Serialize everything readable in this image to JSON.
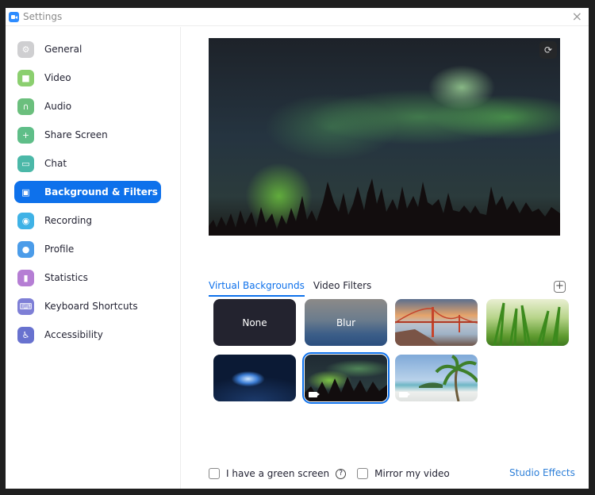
{
  "window": {
    "title": "Settings",
    "close_icon": "×"
  },
  "sidebar": {
    "items": [
      {
        "label": "General",
        "icon": "gear-icon",
        "color": "#cfcfd1",
        "glyph": "⚙"
      },
      {
        "label": "Video",
        "icon": "video-camera-icon",
        "color": "#8bcf6f",
        "glyph": "■"
      },
      {
        "label": "Audio",
        "icon": "headphones-icon",
        "color": "#6bbf7d",
        "glyph": "∩"
      },
      {
        "label": "Share Screen",
        "icon": "share-screen-icon",
        "color": "#5fbe88",
        "glyph": "+"
      },
      {
        "label": "Chat",
        "icon": "chat-bubble-icon",
        "color": "#4bb8a8",
        "glyph": "▭"
      },
      {
        "label": "Background & Filters",
        "icon": "background-icon",
        "color": "#0e71eb",
        "glyph": "▣",
        "active": true
      },
      {
        "label": "Recording",
        "icon": "record-icon",
        "color": "#3fb2e6",
        "glyph": "◉"
      },
      {
        "label": "Profile",
        "icon": "profile-icon",
        "color": "#4b9ce9",
        "glyph": "●"
      },
      {
        "label": "Statistics",
        "icon": "statistics-icon",
        "color": "#b57ed4",
        "glyph": "▮"
      },
      {
        "label": "Keyboard Shortcuts",
        "icon": "keyboard-icon",
        "color": "#7e7fd6",
        "glyph": "⌨"
      },
      {
        "label": "Accessibility",
        "icon": "accessibility-icon",
        "color": "#6872cf",
        "glyph": "♿"
      }
    ]
  },
  "main": {
    "rotate_icon": "⟳",
    "tabs": [
      {
        "label": "Virtual Backgrounds",
        "active": true
      },
      {
        "label": "Video Filters",
        "active": false
      }
    ],
    "add_icon": "+",
    "backgrounds": [
      {
        "name": "none",
        "label": "None"
      },
      {
        "name": "blur",
        "label": "Blur"
      },
      {
        "name": "golden-gate-bridge",
        "label": ""
      },
      {
        "name": "grass",
        "label": ""
      },
      {
        "name": "earth-from-space",
        "label": ""
      },
      {
        "name": "northern-lights",
        "label": "",
        "selected": true
      },
      {
        "name": "beach-palm",
        "label": ""
      }
    ],
    "green_screen_label": "I have a green screen",
    "help_icon": "?",
    "mirror_label": "Mirror my video",
    "studio_effects_label": "Studio Effects"
  }
}
